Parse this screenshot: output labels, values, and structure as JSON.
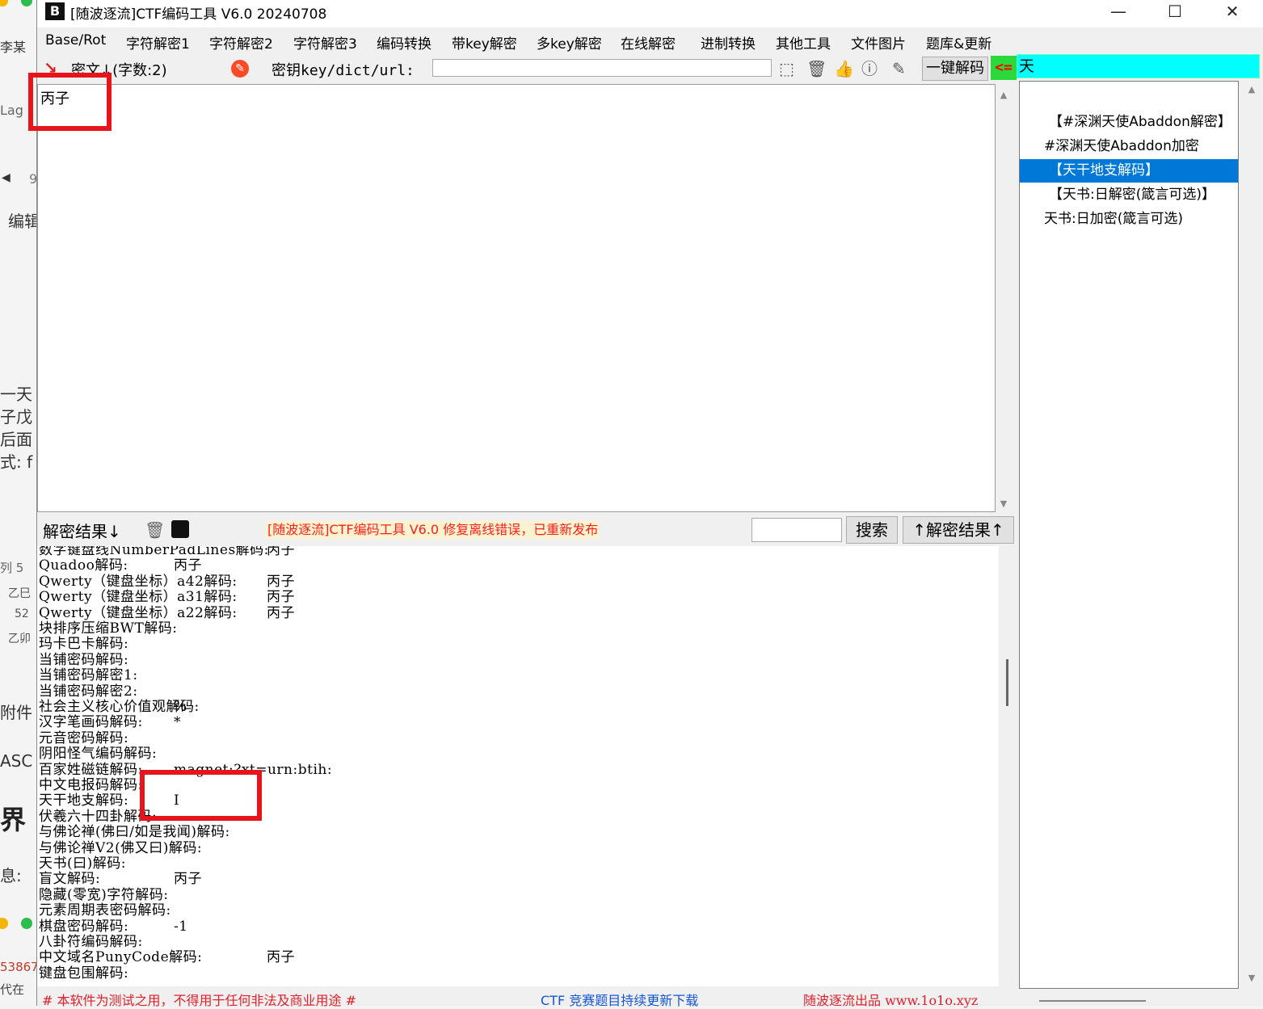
{
  "window": {
    "title": "[随波逐流]CTF编码工具 V6.0 20240708",
    "icon_glyph": "B",
    "minimize": "—",
    "maximize": "☐",
    "close": "✕"
  },
  "menu": [
    "Base/Rot",
    "字符解密1",
    "字符解密2",
    "字符解密3",
    "编码转换",
    "带key解密",
    "多key解密",
    "在线解密",
    "进制转换",
    "其他工具",
    "文件图片",
    "题库&更新"
  ],
  "toolbar": {
    "cipher_label": "密文↓(字数:2)",
    "key_label": "密钥key/dict/url:",
    "key_value": "",
    "decode_button": "一键解码",
    "arrow_indicator": "<=",
    "filter_value": "天"
  },
  "cipher_text": "丙子",
  "method_list": [
    {
      "label": "【#深渊天使Abaddon解密】",
      "selected": false
    },
    {
      "label": "#深渊天使Abaddon加密",
      "selected": false
    },
    {
      "label": "【天干地支解码】",
      "selected": true
    },
    {
      "label": "【天书:日解密(箴言可选)】",
      "selected": false
    },
    {
      "label": "天书:日加密(箴言可选)",
      "selected": false
    }
  ],
  "result_bar": {
    "label": "解密结果↓",
    "notice": "[随波逐流]CTF编码工具 V6.0 修复离线错误，已重新发布",
    "search_value": "",
    "search_button": "搜索",
    "result_up_button": "↑解密结果↑"
  },
  "results": [
    {
      "name": "数字键盘线NumberPadLines解码:",
      "value": "丙子"
    },
    {
      "name": "Quadoo解码:",
      "value": "丙子"
    },
    {
      "name": "Qwerty（键盘坐标）a42解码:",
      "value": "丙子"
    },
    {
      "name": "Qwerty（键盘坐标）a31解码:",
      "value": "丙子"
    },
    {
      "name": "Qwerty（键盘坐标）a22解码:",
      "value": "丙子"
    },
    {
      "name": "块排序压缩BWT解码:",
      "value": ""
    },
    {
      "name": "玛卡巴卡解码:",
      "value": ""
    },
    {
      "name": "当铺密码解码:",
      "value": ""
    },
    {
      "name": "当铺密码解密1:",
      "value": ""
    },
    {
      "name": "当铺密码解密2:",
      "value": ""
    },
    {
      "name": "社会主义核心价值观解码:",
      "value": "%"
    },
    {
      "name": "汉字笔画码解码:",
      "value": "*"
    },
    {
      "name": "元音密码解码:",
      "value": ""
    },
    {
      "name": "阴阳怪气编码解码:",
      "value": ""
    },
    {
      "name": "百家姓磁链解码:",
      "value": "magnet:?xt=urn:btih:"
    },
    {
      "name": "中文电报码解码:",
      "value": ""
    },
    {
      "name": "天干地支解码:",
      "value": "I"
    },
    {
      "name": "伏羲六十四卦解码:",
      "value": ""
    },
    {
      "name": "与佛论禅(佛曰/如是我闻)解码:",
      "value": ""
    },
    {
      "name": "与佛论禅V2(佛又曰)解码:",
      "value": ""
    },
    {
      "name": "天书(曰)解码:",
      "value": ""
    },
    {
      "name": "盲文解码:",
      "value": "丙子"
    },
    {
      "name": "隐藏(零宽)字符解码:",
      "value": ""
    },
    {
      "name": "元素周期表密码解码:",
      "value": ""
    },
    {
      "name": "棋盘密码解码:",
      "value": "-1"
    },
    {
      "name": "八卦符编码解码:",
      "value": ""
    },
    {
      "name": "中文域名PunyCode解码:",
      "value": "丙子"
    },
    {
      "name": "键盘包围解码:",
      "value": ""
    }
  ],
  "status_bar": {
    "left": "# 本软件为测试之用，不得用于任何非法及商业用途 #",
    "center": "CTF 竞赛题目持续更新下载",
    "right": "随波逐流出品 www.1o1o.xyz"
  },
  "background_window": {
    "texts": [
      "李某",
      "Lag",
      "9",
      "编辑",
      "一天",
      "子戊",
      "后面",
      "式: f",
      "列 5",
      "乙巳",
      "52",
      "乙卯",
      "附件",
      "ASC",
      "界",
      "息:",
      "53867",
      "代在"
    ]
  },
  "colors": {
    "selection": "#0078d7",
    "filter_bg": "#00ffff",
    "indicator_bg": "#2bd93b",
    "annotation": "#e8141b",
    "notice_text": "#ff1e1e"
  }
}
